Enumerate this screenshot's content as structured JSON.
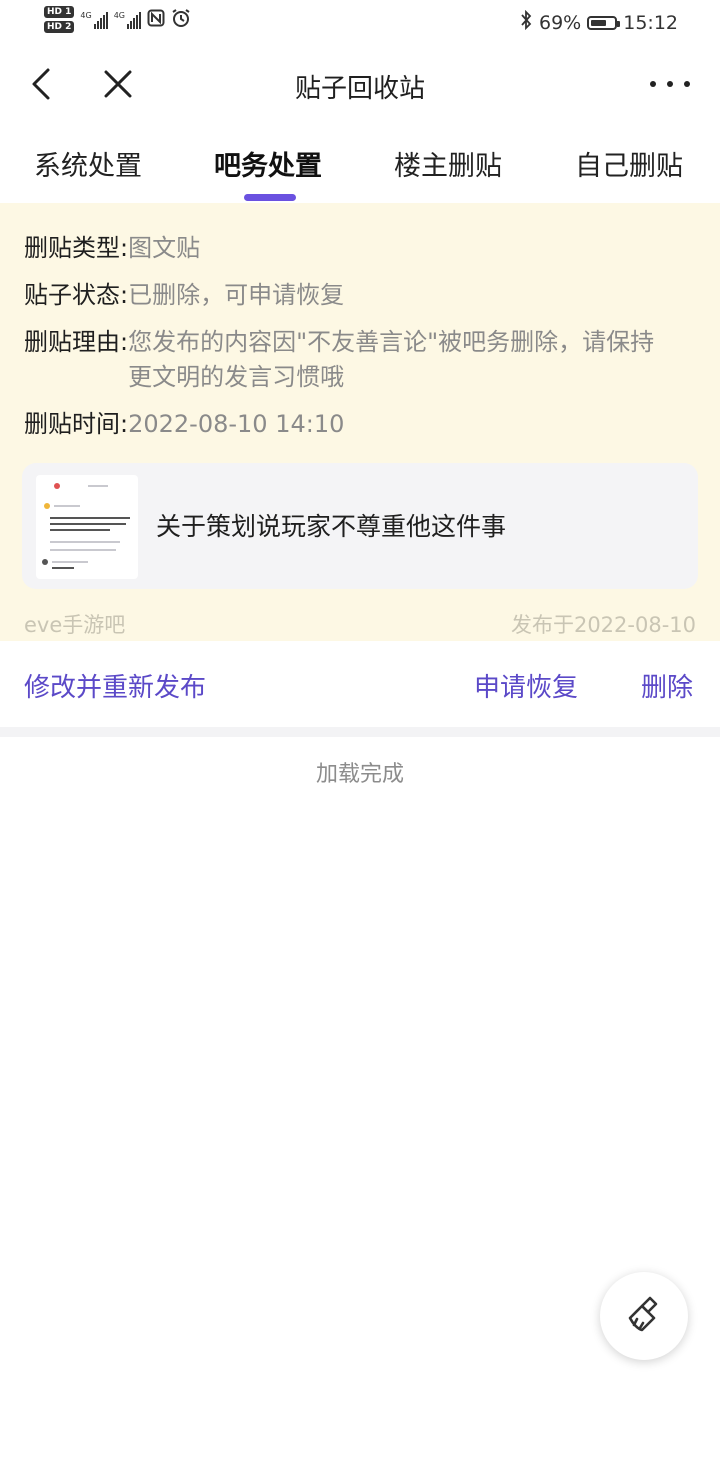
{
  "status_bar": {
    "hd1": "HD 1",
    "hd2": "HD 2",
    "net1": "4G",
    "net2": "4G",
    "battery_percent": "69%",
    "battery_level": 0.69,
    "time": "15:12"
  },
  "nav": {
    "title": "贴子回收站"
  },
  "tabs": [
    {
      "label": "系统处置",
      "active": false
    },
    {
      "label": "吧务处置",
      "active": true
    },
    {
      "label": "楼主删贴",
      "active": false
    },
    {
      "label": "自己删贴",
      "active": false
    }
  ],
  "record": {
    "type_label": "删贴类型:",
    "type_value": "图文贴",
    "status_label": "贴子状态:",
    "status_value": "已删除，可申请恢复",
    "reason_label": "删贴理由:",
    "reason_value": "您发布的内容因\"不友善言论\"被吧务删除，请保持更文明的发言习惯哦",
    "time_label": "删贴时间:",
    "time_value": "2022-08-10 14:10",
    "post_title": "关于策划说玩家不尊重他这件事",
    "forum": "eve手游吧",
    "published": "发布于2022-08-10"
  },
  "actions": {
    "edit_republish": "修改并重新发布",
    "request_restore": "申请恢复",
    "delete": "删除"
  },
  "footer": {
    "loaded_text": "加载完成"
  },
  "colors": {
    "accent": "#6a51e0",
    "action_text": "#5b49c8",
    "card_background": "#fdf8e4"
  },
  "icons": {
    "back": "chevron-left-icon",
    "close": "close-icon",
    "more": "more-dots-icon",
    "fab": "broom-icon"
  }
}
